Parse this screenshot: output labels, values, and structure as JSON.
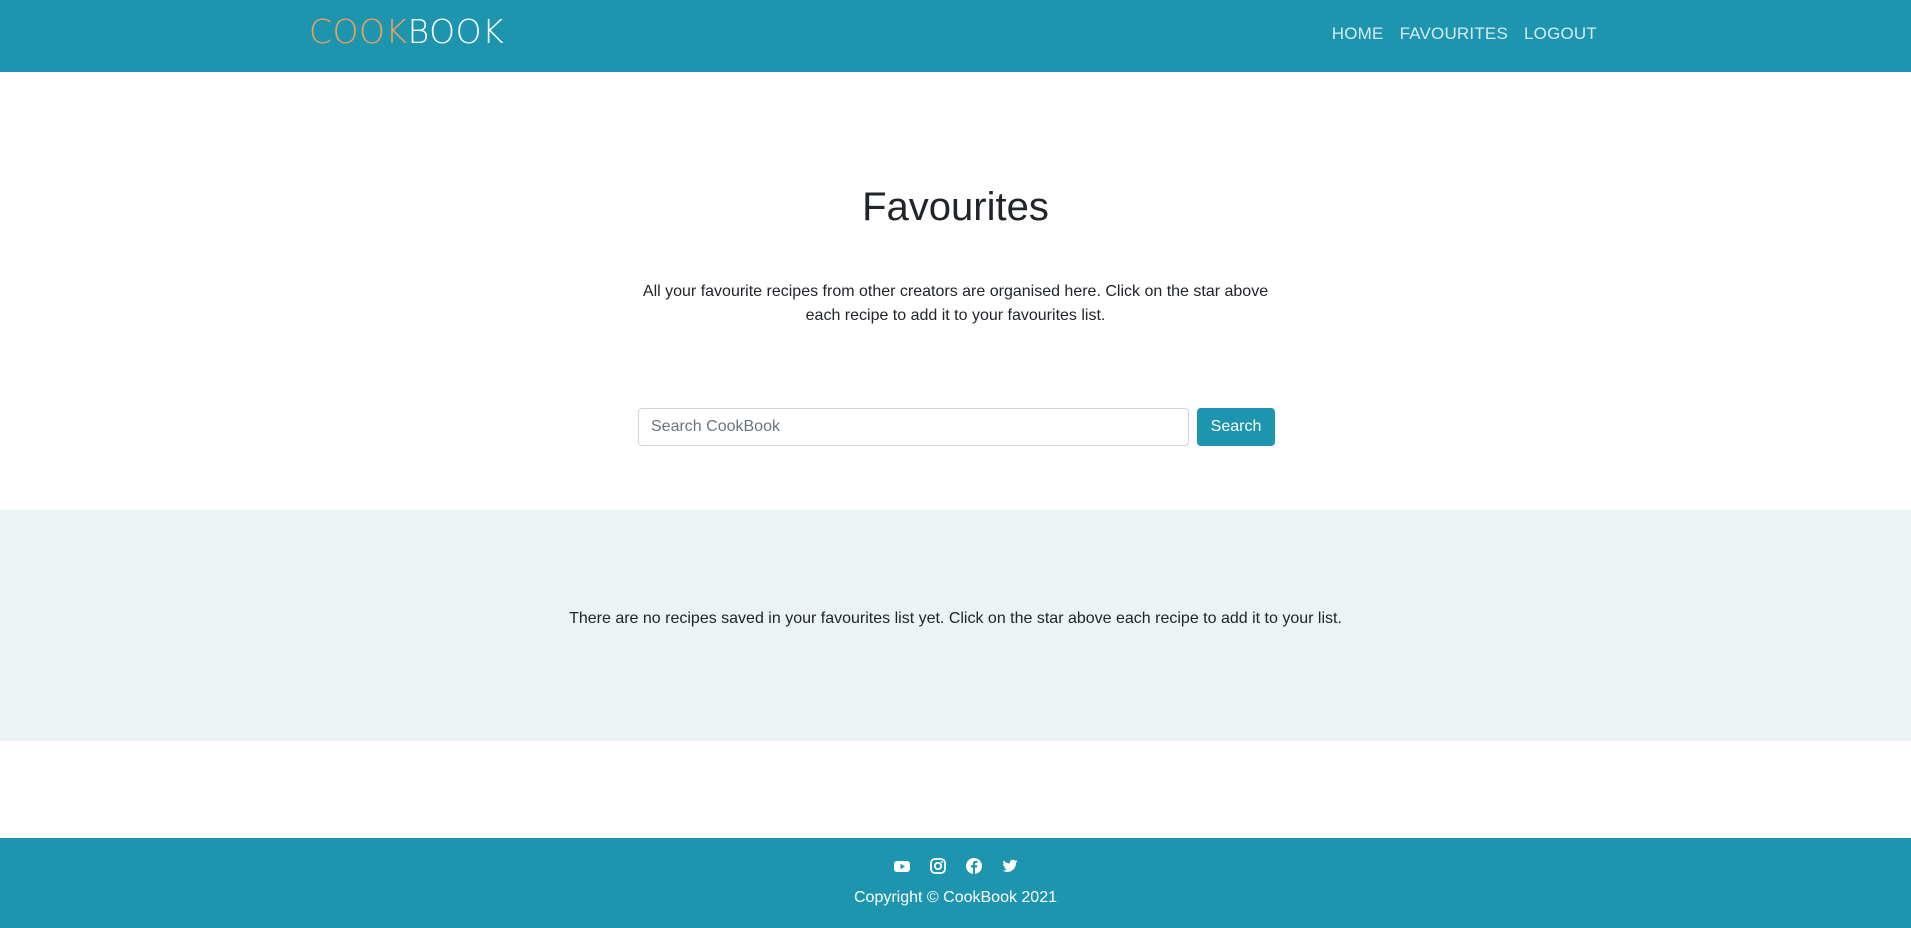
{
  "header": {
    "brand_part1": "COOK",
    "brand_part2": "BOOK",
    "nav": [
      {
        "label": "HOME"
      },
      {
        "label": "FAVOURITES"
      },
      {
        "label": "LOGOUT"
      }
    ]
  },
  "hero": {
    "title": "Favourites",
    "description": "All your favourite recipes from other creators are organised here. Click on the star above each recipe to add it to your favourites list."
  },
  "search": {
    "placeholder": "Search CookBook",
    "value": "",
    "button_label": "Search"
  },
  "favourites": {
    "empty_message": "There are no recipes saved in your favourites list yet. Click on the star above each recipe to add it to your list."
  },
  "footer": {
    "social_icons": [
      "youtube-icon",
      "instagram-icon",
      "facebook-icon",
      "twitter-icon"
    ],
    "copyright": "Copyright © CookBook 2021"
  },
  "colors": {
    "primary": "#1e95af",
    "brand_accent": "#f0a05a",
    "section_bg": "#ebf3f5",
    "nav_link": "#d5ecf2"
  }
}
